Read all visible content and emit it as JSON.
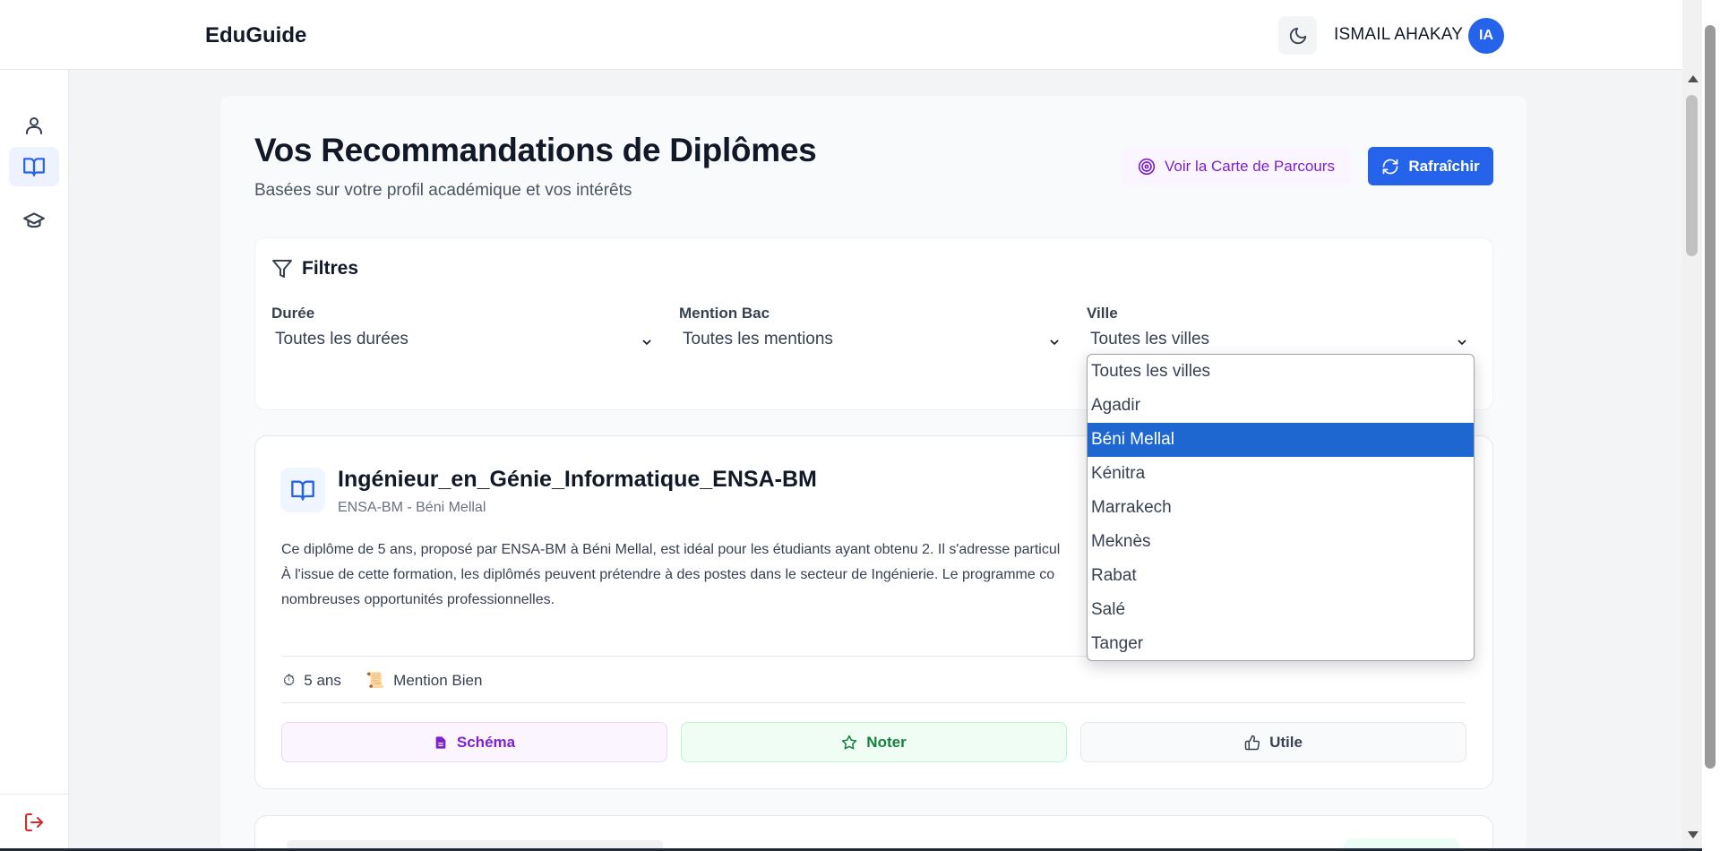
{
  "header": {
    "brand": "EduGuide",
    "user_name": "ISMAIL AHAKAY",
    "avatar_initials": "IA",
    "theme_icon": "moon-icon"
  },
  "sidebar": {
    "items": [
      {
        "name": "profile",
        "icon": "user-icon",
        "active": false
      },
      {
        "name": "recommendations",
        "icon": "book-open-icon",
        "active": true
      },
      {
        "name": "diplomas",
        "icon": "graduation-cap-icon",
        "active": false
      }
    ],
    "logout_icon": "logout-icon"
  },
  "page": {
    "title": "Vos Recommandations de Diplômes",
    "subtitle": "Basées sur votre profil académique et vos intérêts",
    "map_button": "Voir la Carte de Parcours",
    "refresh_button": "Rafraîchir"
  },
  "filters": {
    "heading": "Filtres",
    "duration": {
      "label": "Durée",
      "value": "Toutes les durées"
    },
    "mention": {
      "label": "Mention Bac",
      "value": "Toutes les mentions"
    },
    "city": {
      "label": "Ville",
      "value": "Toutes les villes",
      "options": [
        "Toutes les villes",
        "Agadir",
        "Béni Mellal",
        "Kénitra",
        "Marrakech",
        "Meknès",
        "Rabat",
        "Salé",
        "Tanger"
      ],
      "highlighted": "Béni Mellal"
    }
  },
  "card": {
    "title": "Ingénieur_en_Génie_Informatique_ENSA-BM",
    "subtitle": "ENSA-BM - Béni Mellal",
    "description_lines": [
      "Ce diplôme de 5 ans, proposé par ENSA-BM à Béni Mellal, est idéal pour les étudiants ayant obtenu 2. Il s'adresse particul",
      "À l'issue de cette formation, les diplômés peuvent prétendre à des postes dans le secteur de Ingénierie. Le programme co",
      "nombreuses opportunités professionnelles."
    ],
    "duration": "5 ans",
    "mention": "Mention Bien",
    "actions": {
      "schema": "Schéma",
      "rate": "Noter",
      "useful": "Utile"
    }
  },
  "colors": {
    "primary": "#2563eb",
    "purple": "#7e22ce",
    "green": "#15803d",
    "logout": "#dc2626",
    "dropdown_highlight": "#1e66d0"
  }
}
